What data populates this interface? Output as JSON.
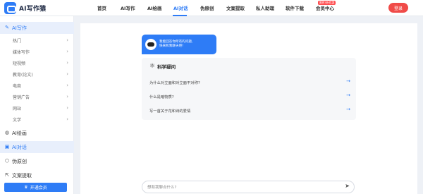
{
  "header": {
    "logo_text": "AI写作猿",
    "nav": [
      {
        "label": "首页"
      },
      {
        "label": "AI写作"
      },
      {
        "label": "AI绘画"
      },
      {
        "label": "AI对话"
      },
      {
        "label": "伪原创"
      },
      {
        "label": "文案提取"
      },
      {
        "label": "私人助理"
      },
      {
        "label": "软件下载"
      },
      {
        "label": "会员中心"
      }
    ],
    "nav_active": "AI对话",
    "badge": "限时5折优惠",
    "login_label": "登录",
    "accent_color": "#2e7cf6",
    "login_color": "#f04b48"
  },
  "sidebar": {
    "ai_writing": {
      "label": "AI写作",
      "subitems": [
        "热门",
        "媒体写作",
        "短视频",
        "教育(论文)",
        "电商",
        "营销广告",
        "网站",
        "文学"
      ]
    },
    "ai_painting": "AI绘画",
    "ai_chat": "AI对话",
    "pseudo_original": "伪原创",
    "copy_extract": "文案提取",
    "vip_button": "开通会员"
  },
  "chat": {
    "bot_greeting_line1": "我能回答你所有的问题,",
    "bot_greeting_line2": "快来和我聊天吧!",
    "card_title": "科学疑问",
    "questions": [
      "为什么对立面和对立面不对称?",
      "什么是暗物质?",
      "写一首关于花和诗的爱情"
    ],
    "input_placeholder": "想和我聊点什么?"
  }
}
